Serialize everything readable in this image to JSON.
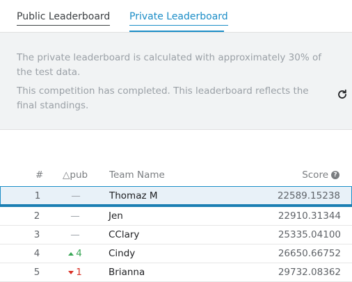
{
  "tabs": {
    "public_label": "Public Leaderboard",
    "private_label": "Private Leaderboard",
    "active": "private"
  },
  "info": {
    "line1": "The private leaderboard is calculated with approximately 30% of the test data.",
    "line2": "This competition has completed. This leaderboard reflects the final standings.",
    "refresh_icon": "refresh-icon"
  },
  "table": {
    "headers": {
      "rank": "#",
      "delta": "△pub",
      "team": "Team Name",
      "score": "Score"
    },
    "rows": [
      {
        "rank": "1",
        "delta": "—",
        "delta_dir": "none",
        "team": "Thomaz M",
        "score": "22589.15238",
        "highlight": true
      },
      {
        "rank": "2",
        "delta": "—",
        "delta_dir": "none",
        "team": "Jen",
        "score": "22910.31344"
      },
      {
        "rank": "3",
        "delta": "—",
        "delta_dir": "none",
        "team": "CClary",
        "score": "25335.04100"
      },
      {
        "rank": "4",
        "delta": "4",
        "delta_dir": "up",
        "team": "Cindy",
        "score": "26650.66752"
      },
      {
        "rank": "5",
        "delta": "1",
        "delta_dir": "down",
        "team": "Brianna",
        "score": "29732.08362"
      }
    ]
  },
  "colors": {
    "accent": "#1b8dc7",
    "up": "#3aa757",
    "down": "#d93025"
  }
}
